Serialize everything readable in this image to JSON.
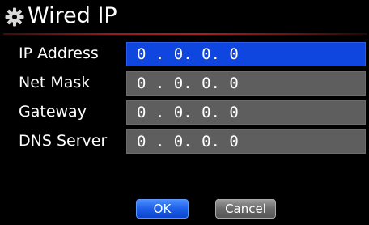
{
  "title": "Wired IP",
  "title_icon": "gear-icon",
  "fields": [
    {
      "label": "IP Address",
      "value": "0 . 0. 0. 0",
      "selected": true
    },
    {
      "label": "Net Mask",
      "value": "0 . 0. 0. 0",
      "selected": false
    },
    {
      "label": "Gateway",
      "value": "0 . 0. 0. 0",
      "selected": false
    },
    {
      "label": "DNS Server",
      "value": "0 . 0. 0. 0",
      "selected": false
    }
  ],
  "buttons": {
    "ok_label": "OK",
    "cancel_label": "Cancel"
  },
  "colors": {
    "selected_field": "#0f46e0",
    "field": "#5e5e5e",
    "title_underline": "#b01c1c",
    "ok_button": "#1d5fe8",
    "cancel_button": "#6a6a6a"
  }
}
